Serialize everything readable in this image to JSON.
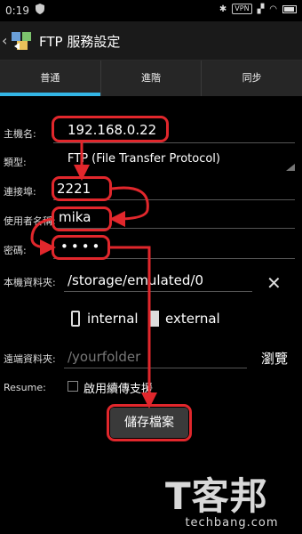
{
  "status_bar": {
    "time": "0:19",
    "vpn": "VPN"
  },
  "app": {
    "title": "FTP 服務設定"
  },
  "tabs": [
    {
      "label": "普通",
      "active": true
    },
    {
      "label": "進階",
      "active": false
    },
    {
      "label": "同步",
      "active": false
    }
  ],
  "form": {
    "host_label": "主機名:",
    "host_value": "192.168.0.22",
    "type_label": "類型:",
    "type_value": "FTP (File Transfer Protocol)",
    "port_label": "連接埠:",
    "port_value": "2221",
    "user_label": "使用者名稱:",
    "user_value": "mika",
    "password_label": "密碼:",
    "password_value": "••••",
    "local_folder_label": "本機資料夾:",
    "local_folder_value": "/storage/emulated/0",
    "storage_internal": "internal",
    "storage_external": "external",
    "remote_folder_label": "遠端資料夾:",
    "remote_folder_placeholder": "/yourfolder",
    "browse_label": "瀏覽",
    "resume_label": "Resume:",
    "resume_option": "啟用續傳支援",
    "save_label": "儲存檔案"
  },
  "watermark": {
    "logo_text": "T客邦",
    "site": "techbang.com"
  },
  "colors": {
    "accent": "#33b5e5",
    "annotation": "#e1272c"
  }
}
